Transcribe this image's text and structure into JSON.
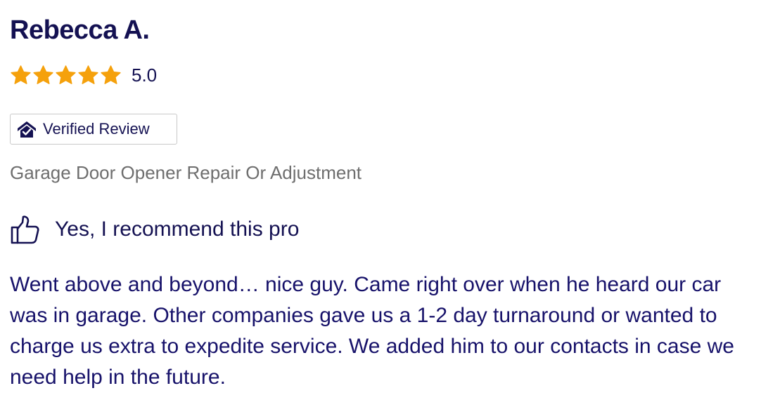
{
  "review": {
    "reviewer_name": "Rebecca A.",
    "rating_value": "5.0",
    "rating": 5,
    "max_rating": 5,
    "star_icon": "star-icon",
    "star_color": "#f5a10c",
    "verified": {
      "label": "Verified Review",
      "icon": "house-check-icon"
    },
    "service": "Garage Door Opener Repair Or Adjustment",
    "recommendation": {
      "label": "Yes, I recommend this pro",
      "icon": "thumbs-up-icon"
    },
    "body": "Went above and beyond… nice guy. Came right over when he heard our car was in garage. Other companies gave us a 1-2 day turnaround or wanted to charge us extra to expedite service. We added him to our contacts in case we need help in the future."
  },
  "colors": {
    "text_primary": "#141152",
    "text_secondary": "#6e6e6e",
    "badge_border": "#c9c9c9"
  }
}
